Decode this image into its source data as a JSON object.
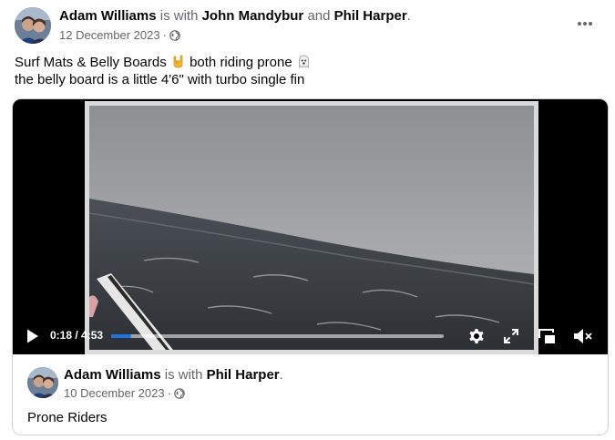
{
  "post": {
    "author": "Adam Williams",
    "with_text": "is with",
    "tagged_1": "John Mandybur",
    "and_text": "and",
    "tagged_2": "Phil Harper",
    "period": ".",
    "date": "12 December 2023",
    "dot": "·",
    "privacy_icon": "globe-icon",
    "more_icon": "more-options-icon",
    "text_line1_a": "Surf Mats & Belly Boards",
    "text_line1_b": "both riding prone",
    "text_line2": "the belly board is a little 4'6\" with turbo single fin",
    "emoji_1": "sign-of-horns-emoji",
    "emoji_2": "ghost-emoji"
  },
  "video": {
    "current_time": "0:18",
    "separator": " / ",
    "duration": "4:53",
    "progress_fraction": 0.061,
    "play_icon": "play-icon",
    "settings_icon": "gear-icon",
    "fullscreen_icon": "fullscreen-icon",
    "pip_icon": "picture-in-picture-icon",
    "mute_icon": "volume-muted-icon",
    "accent_color": "#1b74e4"
  },
  "shared": {
    "author": "Adam Williams",
    "with_text": "is with",
    "tagged": "Phil Harper",
    "period": ".",
    "date": "10 December 2023",
    "dot": "·",
    "privacy_icon": "globe-icon",
    "text": "Prone Riders"
  }
}
